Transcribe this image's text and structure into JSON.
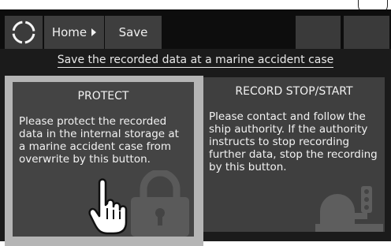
{
  "toolbar": {
    "home_label": "Home",
    "save_label": "Save"
  },
  "header": {
    "instruction": "Save the recorded data at a marine accident case"
  },
  "cards": {
    "protect": {
      "title": "PROTECT",
      "body": "Please protect the recorded data in the internal storage at a marine accident case from overwrite by this button."
    },
    "record": {
      "title": "RECORD STOP/START",
      "body": "Please contact and follow the ship authority. If the authority instructs to stop recording further data, stop the recording by this button."
    }
  },
  "icons": [
    "logo-ring-icon",
    "caret-right-icon",
    "padlock-icon",
    "hand-pointer-icon",
    "recorder-silhouette-icon"
  ],
  "colors": {
    "background": "#1b1b1b",
    "card": "#444444",
    "selected_frame": "#b5b5b5",
    "text": "#f2f2f2"
  }
}
